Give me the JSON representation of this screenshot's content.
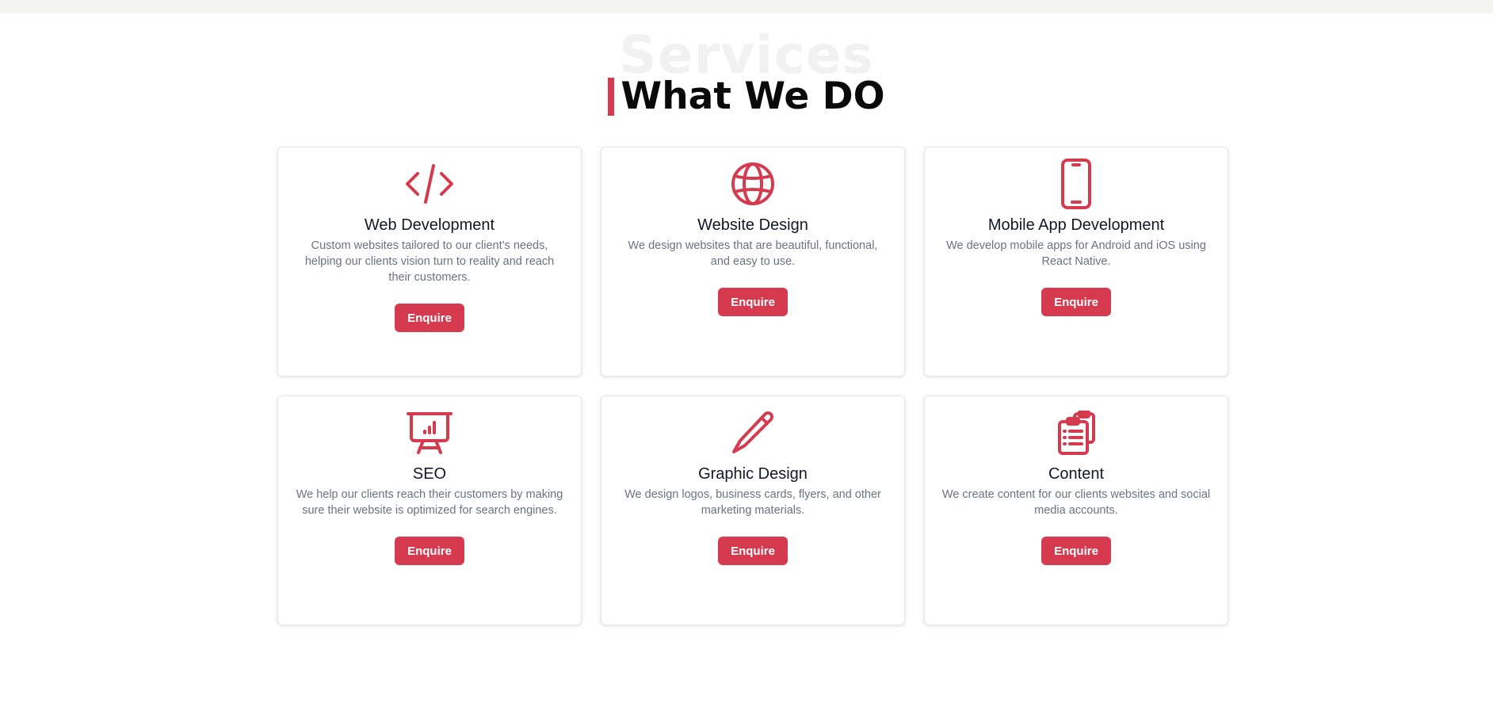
{
  "section": {
    "background_word": "Services",
    "title": "What We DO",
    "accent_color": "#d63a4e"
  },
  "cards": [
    {
      "icon": "code-icon",
      "title": "Web Development",
      "description": "Custom websites tailored to our client’s needs, helping our clients vision turn to reality and reach their customers.",
      "button": "Enquire"
    },
    {
      "icon": "globe-icon",
      "title": "Website Design",
      "description": "We design websites that are beautiful, functional, and easy to use.",
      "button": "Enquire"
    },
    {
      "icon": "mobile-phone-icon",
      "title": "Mobile App Development",
      "description": "We develop mobile apps for Android and iOS using React Native.",
      "button": "Enquire"
    },
    {
      "icon": "presentation-chart-icon",
      "title": "SEO",
      "description": "We help our clients reach their customers by making sure their website is optimized for search engines.",
      "button": "Enquire"
    },
    {
      "icon": "pencil-icon",
      "title": "Graphic Design",
      "description": "We design logos, business cards, flyers, and other marketing materials.",
      "button": "Enquire"
    },
    {
      "icon": "clipboard-list-icon",
      "title": "Content",
      "description": "We create content for our clients websites and social media accounts.",
      "button": "Enquire"
    }
  ]
}
